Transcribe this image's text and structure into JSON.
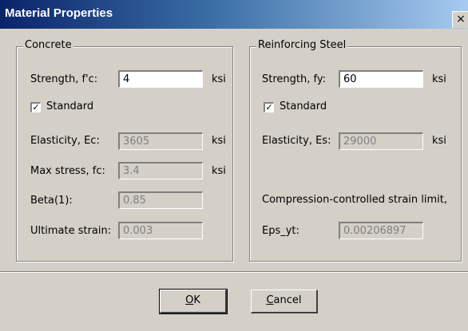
{
  "window": {
    "title": "Material Properties",
    "close_glyph": "×"
  },
  "concrete": {
    "group_label": "Concrete",
    "strength_label": "Strength, f'c:",
    "strength_value": "4",
    "strength_unit": "ksi",
    "standard_label": "Standard",
    "standard_checked": true,
    "elasticity_label": "Elasticity, Ec:",
    "elasticity_value": "3605",
    "elasticity_unit": "ksi",
    "max_stress_label": "Max stress, fc:",
    "max_stress_value": "3.4",
    "max_stress_unit": "ksi",
    "beta_label": "Beta(1):",
    "beta_value": "0.85",
    "ultimate_strain_label": "Ultimate strain:",
    "ultimate_strain_value": "0.003"
  },
  "steel": {
    "group_label": "Reinforcing Steel",
    "strength_label": "Strength, fy:",
    "strength_value": "60",
    "strength_unit": "ksi",
    "standard_label": "Standard",
    "standard_checked": true,
    "elasticity_label": "Elasticity, Es:",
    "elasticity_value": "29000",
    "elasticity_unit": "ksi",
    "strain_limit_label": "Compression-controlled strain limit,",
    "eps_label": "Eps_yt:",
    "eps_value": "0.00206897"
  },
  "buttons": {
    "ok_mnemonic": "O",
    "ok_rest": "K",
    "cancel_mnemonic": "C",
    "cancel_rest": "ancel"
  }
}
